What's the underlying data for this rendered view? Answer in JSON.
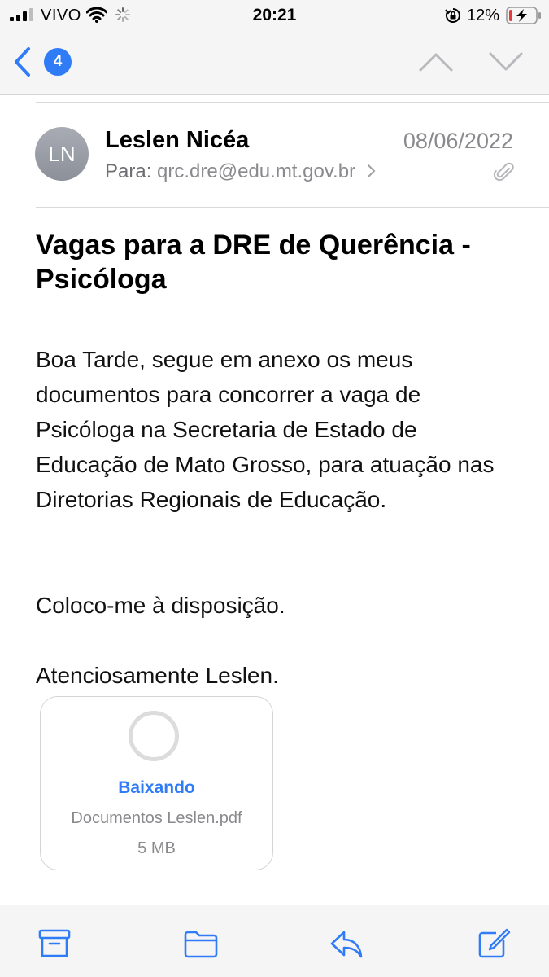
{
  "status_bar": {
    "carrier": "VIVO",
    "time": "20:21",
    "battery_percent": "12%",
    "battery_level": 0.12,
    "battery_color": "#e5393b"
  },
  "nav": {
    "unread_count": "4",
    "accent_color": "#2f7cf6"
  },
  "message": {
    "sender_initials": "LN",
    "sender_name": "Leslen Nicéa",
    "date": "08/06/2022",
    "to_label": "Para:",
    "to_address": "qrc.dre@edu.mt.gov.br",
    "subject": "Vagas para a DRE de Querência - Psicóloga",
    "body_p1": "Boa Tarde, segue em anexo os meus documentos para concorrer a vaga de Psicóloga na Secretaria de Estado de Educação de Mato Grosso, para atuação nas Diretorias Regionais de Educação.",
    "body_p2": "Coloco-me à disposição.",
    "body_p3": "Atenciosamente Leslen."
  },
  "attachment": {
    "status": "Baixando",
    "filename": "Documentos Leslen.pdf",
    "size": "5 MB"
  },
  "toolbar": {
    "icons": [
      "archive-icon",
      "folder-icon",
      "reply-icon",
      "compose-icon"
    ]
  }
}
